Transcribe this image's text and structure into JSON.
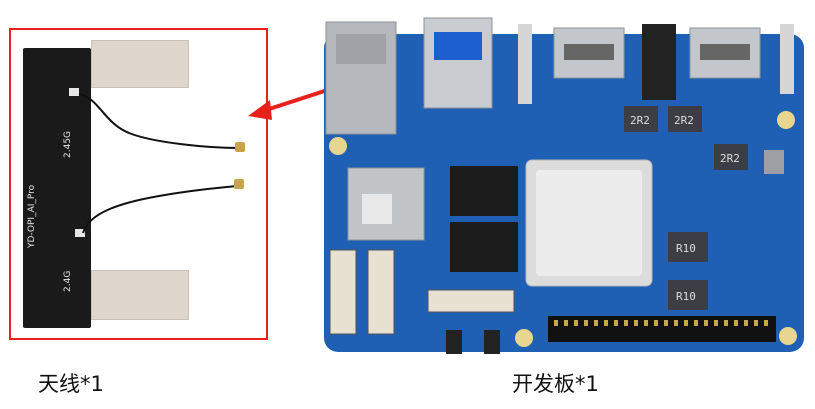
{
  "antenna": {
    "model_label": "YD-OPI_AI_Pro",
    "band_5g_label": "2.45G",
    "band_24g_label": "2.4G"
  },
  "board": {
    "inductor_labels": [
      "2R2",
      "2R2",
      "2R2",
      "R10",
      "R10"
    ]
  },
  "captions": {
    "antenna": "天线*1",
    "board": "开发板*1"
  },
  "colors": {
    "highlight_red": "#e8211c",
    "board_blue": "#1f5fb4",
    "antenna_black": "#1a1a1a"
  }
}
